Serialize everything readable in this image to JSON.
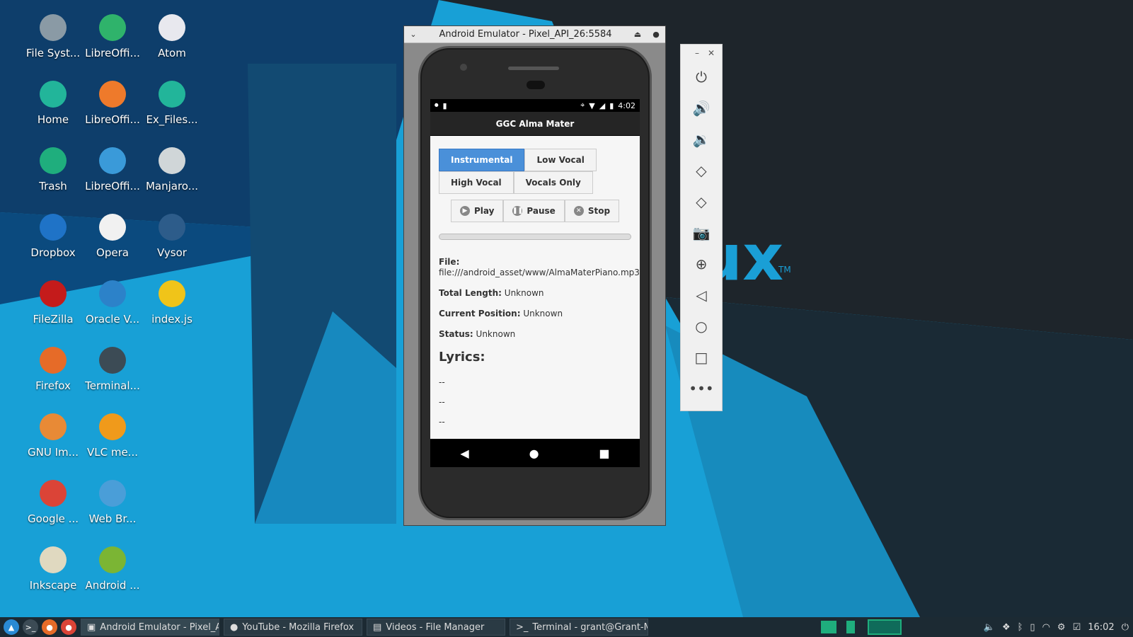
{
  "desktop": {
    "icons": [
      {
        "label": "File Syst...",
        "icon": "filesystem-icon",
        "color": "#8a9aa5"
      },
      {
        "label": "LibreOffi...",
        "icon": "calc-icon",
        "color": "#2fb36b"
      },
      {
        "label": "Atom",
        "icon": "atom-icon",
        "color": "#e8e8ee"
      },
      {
        "label": "Home",
        "icon": "home-folder-icon",
        "color": "#22b59a"
      },
      {
        "label": "LibreOffi...",
        "icon": "impress-icon",
        "color": "#ee7a2b"
      },
      {
        "label": "Ex_Files...",
        "icon": "folder-icon",
        "color": "#22b59a"
      },
      {
        "label": "Trash",
        "icon": "trash-icon",
        "color": "#1fae7d"
      },
      {
        "label": "LibreOffi...",
        "icon": "writer-icon",
        "color": "#3a9ad9"
      },
      {
        "label": "Manjaro...",
        "icon": "settings-toggle-icon",
        "color": "#d0d6d8"
      },
      {
        "label": "Dropbox",
        "icon": "dropbox-icon",
        "color": "#1f73c7"
      },
      {
        "label": "Opera",
        "icon": "opera-icon",
        "color": "#f1f1f1"
      },
      {
        "label": "Vysor",
        "icon": "vysor-icon",
        "color": "#2d5c8a"
      },
      {
        "label": "FileZilla",
        "icon": "filezilla-icon",
        "color": "#c41b1b"
      },
      {
        "label": "Oracle V...",
        "icon": "virtualbox-icon",
        "color": "#2c82c9"
      },
      {
        "label": "index.js",
        "icon": "js-file-icon",
        "color": "#f0c419"
      },
      {
        "label": "Firefox",
        "icon": "firefox-icon",
        "color": "#e66b28"
      },
      {
        "label": "Terminal...",
        "icon": "terminal-icon",
        "color": "#3c4b55"
      },
      {
        "label": "GNU Im...",
        "icon": "gimp-icon",
        "color": "#e88a36"
      },
      {
        "label": "VLC me...",
        "icon": "vlc-icon",
        "color": "#f09a1b"
      },
      {
        "label": "Google ...",
        "icon": "chrome-icon",
        "color": "#db4437"
      },
      {
        "label": "Web Br...",
        "icon": "globe-icon",
        "color": "#4a9ed8"
      },
      {
        "label": "Inkscape",
        "icon": "inkscape-icon",
        "color": "#e0d9c0"
      },
      {
        "label": "Android ...",
        "icon": "android-icon",
        "color": "#7bb534"
      }
    ]
  },
  "emulator": {
    "title": "Android Emulator - Pixel_API_26:5584",
    "status_time": "4:02",
    "app_title": "GGC Alma Mater",
    "tabs": [
      "Instrumental",
      "Low Vocal",
      "High Vocal",
      "Vocals Only"
    ],
    "controls": {
      "play": "Play",
      "pause": "Pause",
      "stop": "Stop"
    },
    "progress": 0,
    "file_label": "File:",
    "file_value": "file:///android_asset/www/AlmaMaterPiano.mp3",
    "total_label": "Total Length:",
    "total_value": "Unknown",
    "position_label": "Current Position:",
    "position_value": "Unknown",
    "status_label": "Status:",
    "status_value": "Unknown",
    "lyrics_heading": "Lyrics:",
    "lyrics_lines": [
      "--",
      "--",
      "--"
    ]
  },
  "side_toolbar": {
    "buttons": [
      "power",
      "volume-up",
      "volume-down",
      "rotate-left",
      "rotate-right",
      "camera",
      "zoom",
      "back",
      "home",
      "overview",
      "more"
    ]
  },
  "taskbar": {
    "tasks": [
      "Android Emulator - Pixel_A...",
      "YouTube - Mozilla Firefox",
      "Videos - File Manager",
      "Terminal - grant@Grant-M..."
    ],
    "clock": "16:02"
  }
}
